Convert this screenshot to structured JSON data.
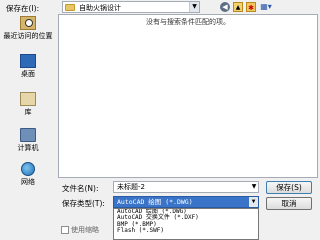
{
  "toolbar": {
    "save_in_label": "保存在(I):",
    "location": "自助火锅设计"
  },
  "places": [
    {
      "label": "最近访问的位置",
      "icon": "recent-places-icon"
    },
    {
      "label": "桌面",
      "icon": "desktop-icon"
    },
    {
      "label": "库",
      "icon": "libraries-icon"
    },
    {
      "label": "计算机",
      "icon": "computer-icon"
    },
    {
      "label": "网络",
      "icon": "network-icon"
    }
  ],
  "file_list": {
    "empty_message": "没有与搜索条件匹配的项。"
  },
  "form": {
    "filename_label": "文件名(N):",
    "filename_value": "未标题-2",
    "filetype_label": "保存类型(T):",
    "filetype_value": "AutoCAD 绘图 (*.DWG)",
    "filetype_options": [
      "AutoCAD 绘图 (*.DWG)",
      "AutoCAD 交换文件 (*.DXF)",
      "BMP (*.BMP)",
      "Flash (*.SWF)"
    ],
    "save_label": "保存(S)",
    "cancel_label": "取消",
    "thumbnail_label": "使用缩略"
  },
  "colors": {
    "selection": "#3a74c8",
    "background": "#f0f0f0"
  }
}
